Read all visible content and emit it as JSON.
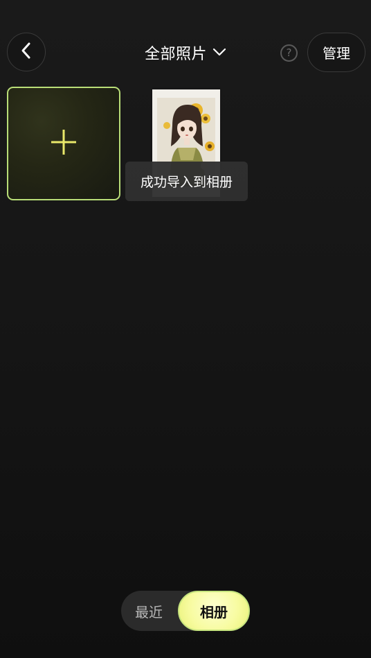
{
  "header": {
    "title": "全部照片",
    "back_icon": "chevron-left-icon",
    "dropdown_icon": "chevron-down-icon",
    "help_icon": "question-circle-icon",
    "help_glyph": "?",
    "manage_label": "管理"
  },
  "grid": {
    "add_tile_icon": "plus-icon",
    "photo_items": [
      {
        "kind": "instant-photo",
        "subject": "girl-with-sunflowers"
      }
    ]
  },
  "toast": {
    "text": "成功导入到相册"
  },
  "segmented": {
    "recent_label": "最近",
    "album_label": "相册",
    "selected": "album"
  },
  "colors": {
    "background": "#161616",
    "accent_border": "#b9de78",
    "accent_fill": "#f7fb9f",
    "plus": "#e9e86a"
  }
}
